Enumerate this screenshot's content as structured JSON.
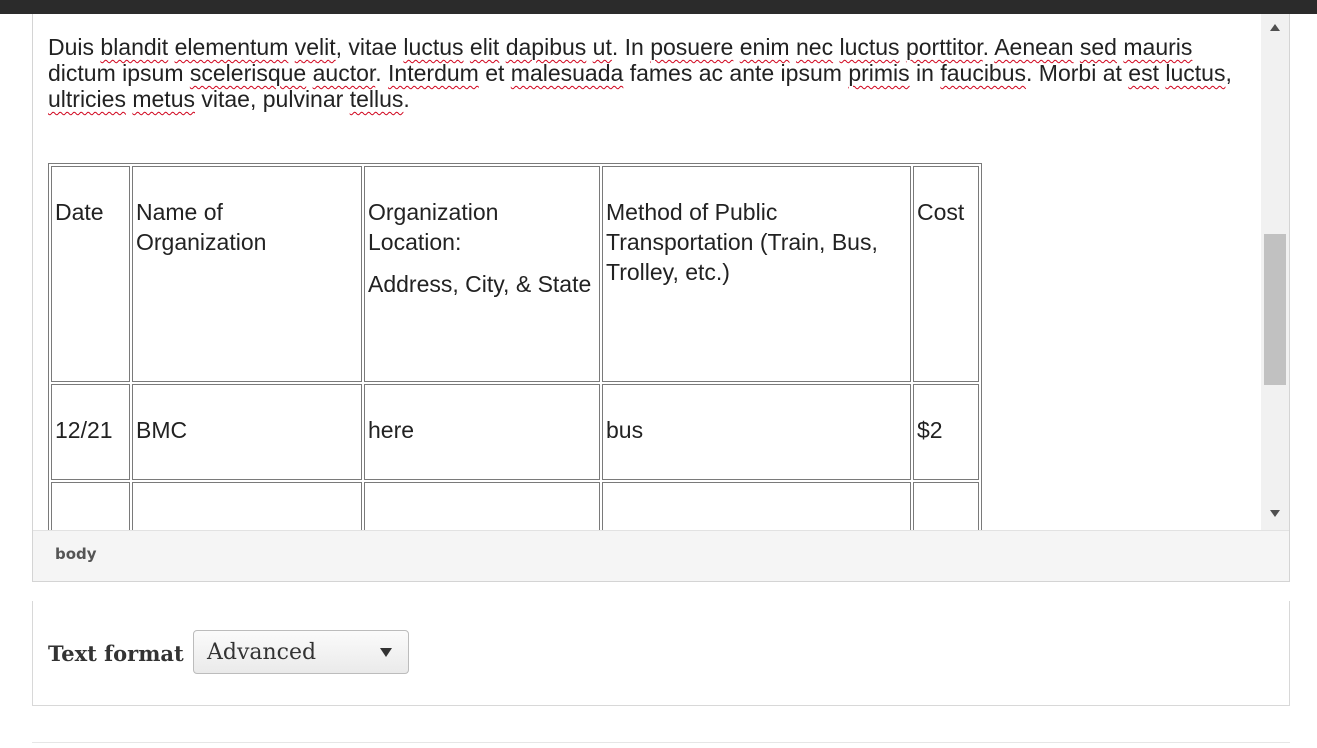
{
  "editor": {
    "paragraph": [
      [
        "Duis ",
        false
      ],
      [
        "blandit",
        true
      ],
      [
        " ",
        false
      ],
      [
        "elementum",
        true
      ],
      [
        " ",
        false
      ],
      [
        "velit",
        true
      ],
      [
        ", vitae ",
        false
      ],
      [
        "luctus",
        true
      ],
      [
        " ",
        false
      ],
      [
        "elit",
        true
      ],
      [
        " ",
        false
      ],
      [
        "dapibus",
        true
      ],
      [
        " ",
        false
      ],
      [
        "ut",
        true
      ],
      [
        ". In ",
        false
      ],
      [
        "posuere",
        true
      ],
      [
        " ",
        false
      ],
      [
        "enim",
        true
      ],
      [
        " ",
        false
      ],
      [
        "nec",
        true
      ],
      [
        " ",
        false
      ],
      [
        "luctus",
        true
      ],
      [
        " ",
        false
      ],
      [
        "porttitor",
        true
      ],
      [
        ". ",
        false
      ],
      [
        "Aenean",
        true
      ],
      [
        " ",
        false
      ],
      [
        "sed",
        true
      ],
      [
        " ",
        false
      ],
      [
        "mauris",
        true
      ],
      [
        " dictum ipsum ",
        false
      ],
      [
        "scelerisque",
        true
      ],
      [
        " ",
        false
      ],
      [
        "auctor",
        true
      ],
      [
        ". ",
        false
      ],
      [
        "Interdum",
        true
      ],
      [
        " et ",
        false
      ],
      [
        "malesuada",
        true
      ],
      [
        " fames ac ante ipsum ",
        false
      ],
      [
        "primis",
        true
      ],
      [
        " in ",
        false
      ],
      [
        "faucibus",
        true
      ],
      [
        ". Morbi at ",
        false
      ],
      [
        "est",
        true
      ],
      [
        " ",
        false
      ],
      [
        "luctus",
        true
      ],
      [
        ", ",
        false
      ],
      [
        "ultricies",
        true
      ],
      [
        " ",
        false
      ],
      [
        "metus",
        true
      ],
      [
        " vitae, pulvinar ",
        false
      ],
      [
        "tellus",
        true
      ],
      [
        ".",
        false
      ]
    ],
    "table": {
      "headers": {
        "date": "Date",
        "name": "Name of Organization",
        "location_line1": "Organization Location:",
        "location_line2": "Address, City, & State",
        "method": "Method of Public Transportation (Train, Bus, Trolley, etc.)",
        "cost": "Cost"
      },
      "rows": [
        {
          "date": "12/21",
          "name": "BMC",
          "location": "here",
          "method": "bus",
          "cost": "$2"
        },
        {
          "date": "",
          "name": "",
          "location": "",
          "method": "",
          "cost": ""
        }
      ]
    }
  },
  "pathbar": {
    "element": "body"
  },
  "text_format": {
    "label": "Text format",
    "selected": "Advanced"
  }
}
